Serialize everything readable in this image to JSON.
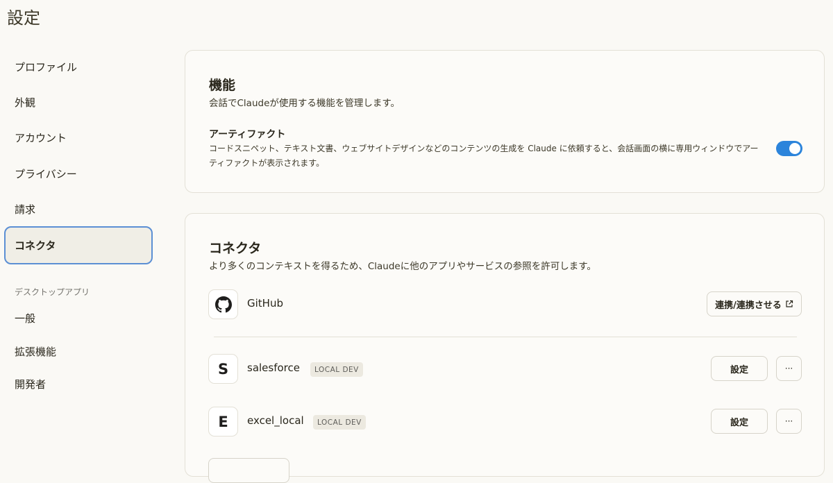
{
  "page": {
    "title": "設定"
  },
  "sidebar": {
    "items": [
      {
        "label": "プロファイル"
      },
      {
        "label": "外観"
      },
      {
        "label": "アカウント"
      },
      {
        "label": "プライバシー"
      },
      {
        "label": "請求"
      },
      {
        "label": "コネクタ",
        "active": true
      }
    ],
    "desktop_section_label": "デスクトップアプリ",
    "desktop_items": [
      {
        "label": "一般"
      },
      {
        "label": "拡張機能"
      },
      {
        "label": "開発者"
      }
    ]
  },
  "features": {
    "title": "機能",
    "description": "会話でClaudeが使用する機能を管理します。",
    "artifacts": {
      "name": "アーティファクト",
      "description": "コードスニペット、テキスト文書、ウェブサイトデザインなどのコンテンツの生成を Claude に依頼すると、会話画面の横に専用ウィンドウでアーティファクトが表示されます。",
      "enabled": true
    }
  },
  "connectors": {
    "title": "コネクタ",
    "description": "より多くのコンテキストを得るため、Claudeに他のアプリやサービスの参照を許可します。",
    "items": [
      {
        "name": "GitHub",
        "icon": "github-icon",
        "button_label": "連携/連携させる",
        "button_icon": "external-link-icon"
      },
      {
        "name": "salesforce",
        "icon_letter": "S",
        "badge": "LOCAL DEV",
        "button_label": "設定",
        "more_label": "···"
      },
      {
        "name": "excel_local",
        "icon_letter": "E",
        "badge": "LOCAL DEV",
        "button_label": "設定",
        "more_label": "···"
      }
    ]
  },
  "colors": {
    "accent": "#2c84db",
    "active_border": "#5b8fd4",
    "background": "#faf9f5"
  }
}
